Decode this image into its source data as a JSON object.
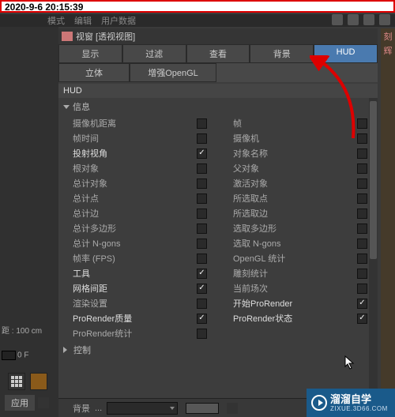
{
  "timestamp": "2020-9-6 20:15:39",
  "menubar": {
    "items": [
      "模式",
      "编辑",
      "用户数据"
    ]
  },
  "panel": {
    "title": "视窗 [透视视图]"
  },
  "tabs": {
    "row1": [
      {
        "label": "显示",
        "active": false
      },
      {
        "label": "过滤",
        "active": false
      },
      {
        "label": "查看",
        "active": false
      },
      {
        "label": "背景",
        "active": false
      },
      {
        "label": "HUD",
        "active": true
      }
    ],
    "row2": [
      {
        "label": "立体"
      },
      {
        "label": "增强OpenGL"
      }
    ]
  },
  "section_title": "HUD",
  "groups": {
    "info": "信息",
    "control": "控制"
  },
  "props": [
    {
      "l": "摄像机距离",
      "lc": false,
      "r": "帧",
      "rc": false
    },
    {
      "l": "帧时间",
      "lc": false,
      "r": "摄像机",
      "rc": false
    },
    {
      "l": "投射视角",
      "lc": true,
      "r": "对象名称",
      "rc": false
    },
    {
      "l": "根对象",
      "lc": false,
      "r": "父对象",
      "rc": false
    },
    {
      "l": "总计对象",
      "lc": false,
      "r": "激活对象",
      "rc": false
    },
    {
      "l": "总计点",
      "lc": false,
      "r": "所选取点",
      "rc": false
    },
    {
      "l": "总计边",
      "lc": false,
      "r": "所选取边",
      "rc": false
    },
    {
      "l": "总计多边形",
      "lc": false,
      "r": "选取多边形",
      "rc": false
    },
    {
      "l": "总计 N-gons",
      "lc": false,
      "r": "选取 N-gons",
      "rc": false
    },
    {
      "l": "帧率 (FPS)",
      "lc": false,
      "r": "OpenGL 统计",
      "rc": false
    },
    {
      "l": "工具",
      "lc": true,
      "r": "雕刻统计",
      "rc": false
    },
    {
      "l": "网格间距",
      "lc": true,
      "r": "当前场次",
      "rc": false
    },
    {
      "l": "渲染设置",
      "lc": false,
      "r": "开始ProRender",
      "rc": true
    },
    {
      "l": "ProRender质量",
      "lc": true,
      "r": "ProRender状态",
      "rc": true
    },
    {
      "l": "ProRender统计",
      "lc": false,
      "r": "",
      "rc": null
    }
  ],
  "bottom": {
    "label": "背景",
    "dots": "..."
  },
  "left": {
    "dist": "距 : 100 cm",
    "zero": "0 F",
    "apply": "应用"
  },
  "watermark": {
    "brand": "溜溜自学",
    "url": "ZIXUE.3D66.COM"
  }
}
